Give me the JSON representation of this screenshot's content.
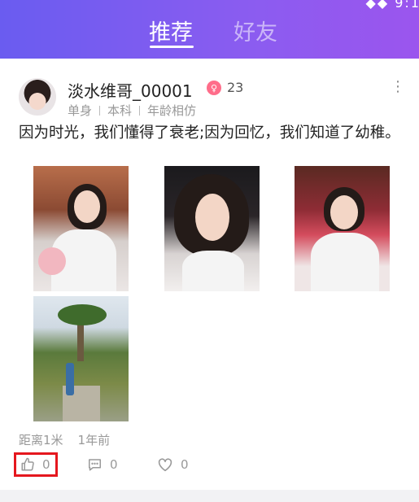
{
  "header": {
    "status_glyphs": "◆◆ 9:1",
    "tabs": [
      {
        "label": "推荐",
        "active": true
      },
      {
        "label": "好友",
        "active": false
      }
    ],
    "gradient_colors": [
      "#6a5cf0",
      "#9b55ee"
    ]
  },
  "post": {
    "user": {
      "name": "淡水维哥_00001",
      "gender_icon": "female-symbol",
      "gender_glyph": "♀",
      "age": "23",
      "tags": [
        "单身",
        "本科",
        "年龄相仿"
      ]
    },
    "text": "因为时光，我们懂得了衰老;因为回忆，我们知道了幼稚。",
    "photos": [
      "photo-1",
      "photo-2",
      "photo-3",
      "photo-4"
    ],
    "distance": "距离1米",
    "time": "1年前",
    "actions": {
      "like_count": "0",
      "comment_count": "0",
      "favorite_count": "0"
    }
  },
  "colors": {
    "highlight": "#e5171e",
    "gender_badge": "#ff6d8a"
  }
}
